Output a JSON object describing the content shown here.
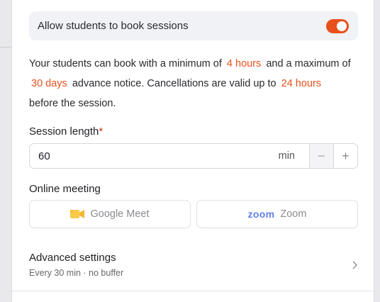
{
  "booking": {
    "toggle_label": "Allow students to book sessions",
    "toggle_on": true,
    "notice": {
      "part1": "Your students can book with a minimum of",
      "min_notice": "4 hours",
      "part2": "and a maximum of",
      "max_notice": "30 days",
      "part3": "advance notice. Cancellations are valid up to",
      "cancel_window": "24 hours",
      "part4": "before the session."
    }
  },
  "session_length": {
    "label": "Session length",
    "required_mark": "*",
    "value": "60",
    "unit": "min",
    "decrement": "−",
    "increment": "+"
  },
  "online_meeting": {
    "label": "Online meeting",
    "options": [
      {
        "icon": "google-meet-icon",
        "label": "Google Meet"
      },
      {
        "icon": "zoom-logo",
        "logo_text": "zoom",
        "label": "Zoom"
      }
    ]
  },
  "advanced": {
    "title": "Advanced settings",
    "subtitle": "Every 30 min · no buffer"
  },
  "colors": {
    "accent": "#e8501c",
    "zoom_blue": "#5f7fe8",
    "meet_yellow": "#f9c94a"
  }
}
